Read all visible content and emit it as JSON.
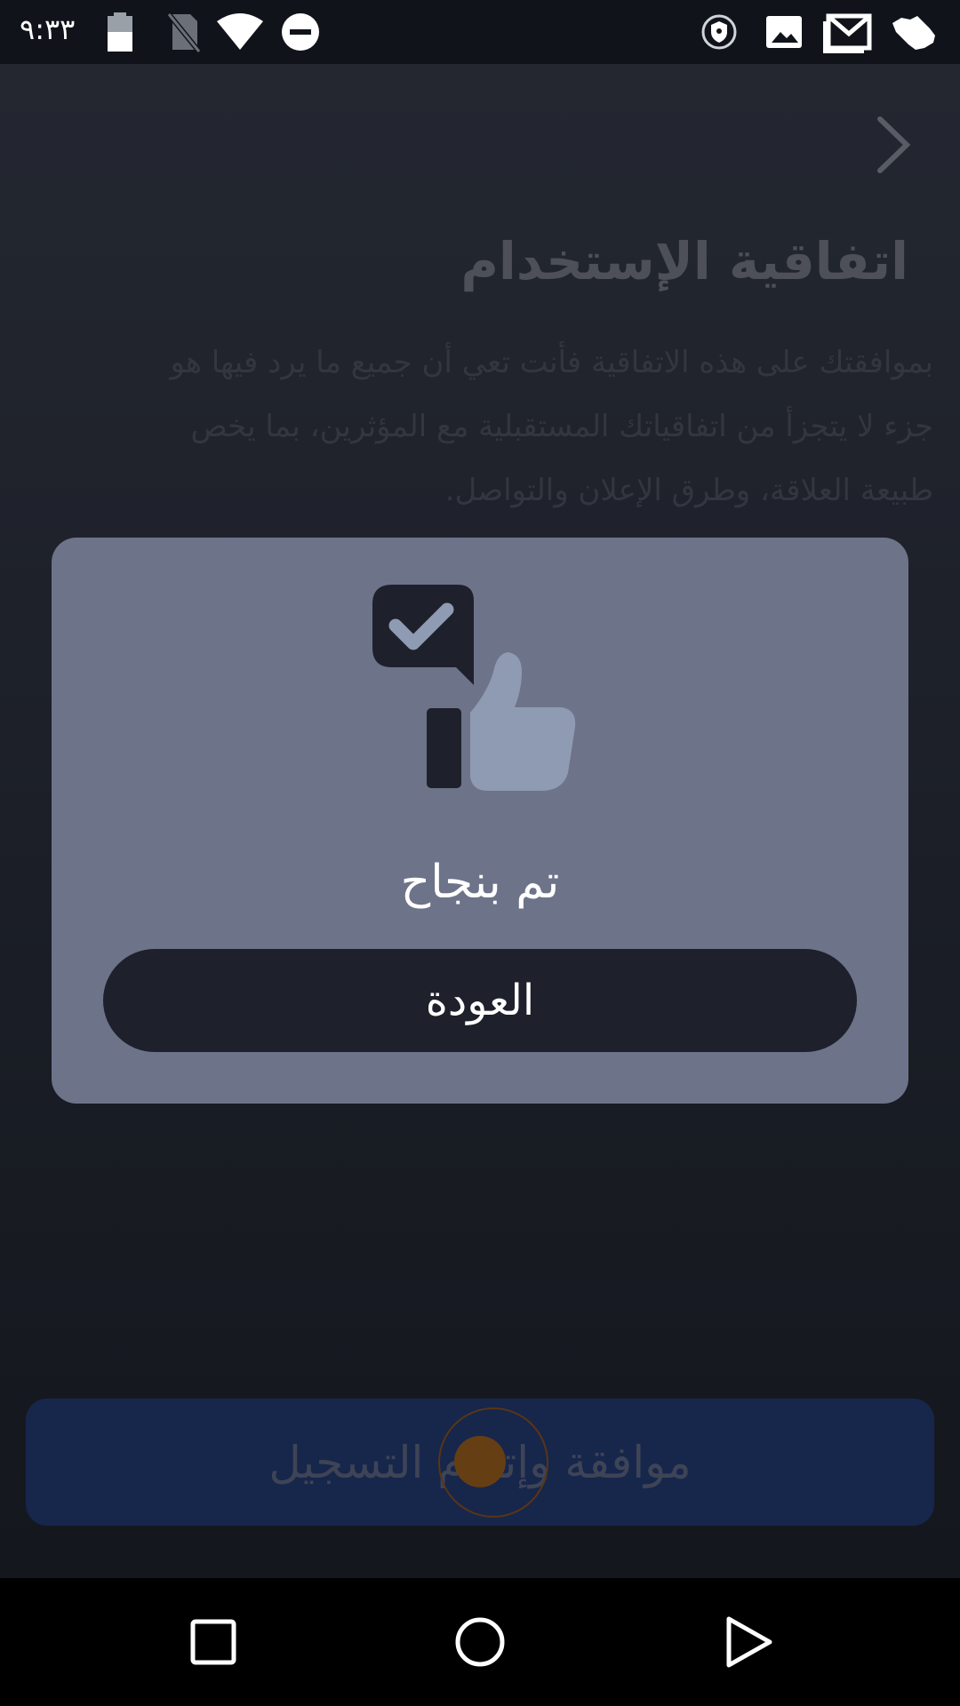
{
  "status_bar": {
    "time": "٩:٣٣",
    "icons": [
      "battery-icon",
      "no-sim-icon",
      "wifi-icon",
      "do-not-disturb-icon",
      "vpn-shield-icon",
      "image-notification-icon",
      "gmail-icon",
      "saudi-map-icon"
    ]
  },
  "header": {
    "back_icon": "chevron-right-icon",
    "title": "اتفاقية الإستخدام"
  },
  "agreement": {
    "lines": [
      "بموافقتك على هذه الاتفاقية فأنت تعي أن جميع ما يرد فيها هو",
      "جزء لا يتجزأ من اتفاقياتك المستقبلية مع المؤثرين، بما يخص",
      "طبيعة العلاقة، وطرق الإعلان والتواصل."
    ]
  },
  "primary_action": {
    "label": "موافقة وإتمام التسجيل"
  },
  "dialog": {
    "illustration": "approval-thumbs-up-icon",
    "message": "تم بنجاح",
    "back_label": "العودة"
  },
  "nav_bar": {
    "items": [
      "recents-square-icon",
      "home-circle-icon",
      "back-triangle-icon"
    ]
  },
  "colors": {
    "dialog_bg": "#6d7389",
    "button_dark": "#1e212b",
    "primary_blue": "#1a2d58",
    "thumb": "#8f9ab3"
  }
}
